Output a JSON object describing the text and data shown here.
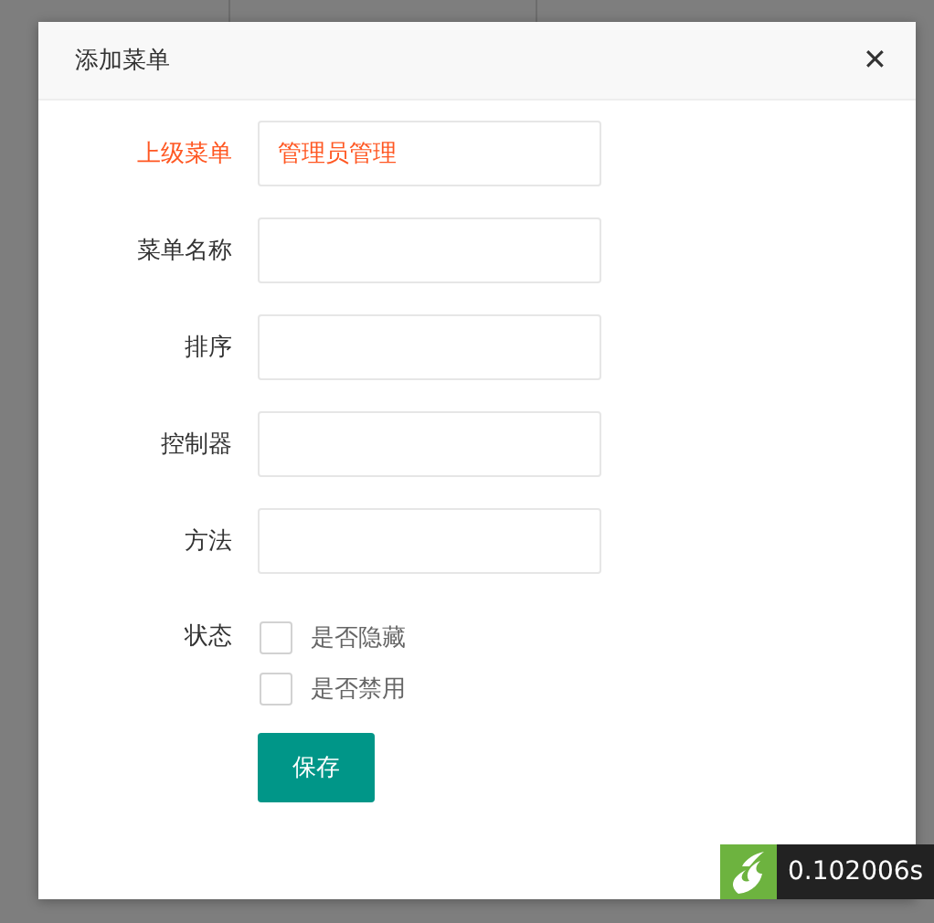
{
  "dialog": {
    "title": "添加菜单",
    "close": "✕"
  },
  "fields": [
    {
      "label": "上级菜单",
      "value": "管理员管理",
      "highlighted": true
    },
    {
      "label": "菜单名称",
      "highlighted": false
    },
    {
      "label": "排序",
      "highlighted": false
    },
    {
      "label": "控制器",
      "highlighted": false
    },
    {
      "label": "方法",
      "highlighted": false
    }
  ],
  "status": {
    "label": "状态",
    "options": [
      {
        "label": "是否隐藏",
        "checked": false
      },
      {
        "label": "是否禁用",
        "checked": false
      }
    ]
  },
  "buttons": [
    {
      "label": "保存"
    }
  ],
  "debug_badge": {
    "time": "0.102006s"
  }
}
